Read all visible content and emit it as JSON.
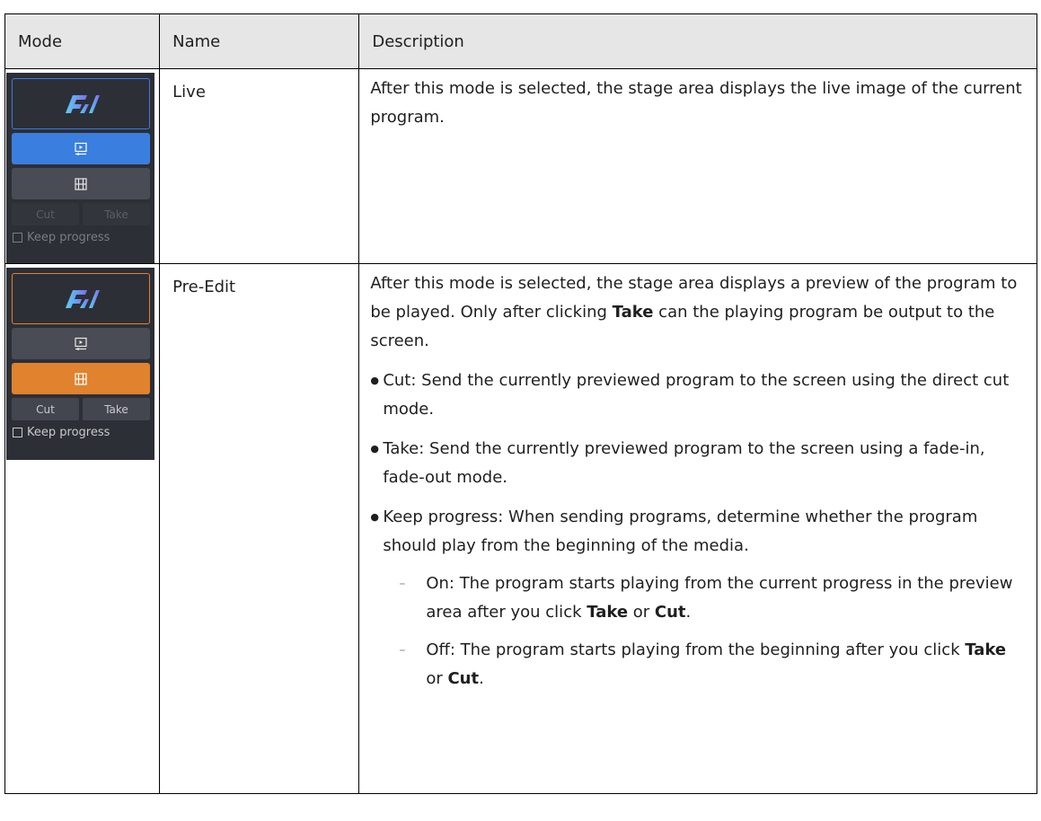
{
  "table": {
    "headers": [
      "Mode",
      "Name",
      "Description"
    ],
    "rows": [
      {
        "panel": {
          "cut_label": "Cut",
          "take_label": "Take",
          "keep_label": "Keep progress",
          "active_color": "#3a7fdf"
        },
        "name": "Live",
        "desc": "After this mode is selected, the stage area displays the live image of the current program."
      },
      {
        "panel": {
          "cut_label": "Cut",
          "take_label": "Take",
          "keep_label": "Keep progress",
          "active_color": "#e0822e"
        },
        "name": "Pre-Edit",
        "desc_intro_1": "After this mode is selected, the stage area displays a preview of the program to be played. Only after clicking ",
        "desc_intro_take": "Take",
        "desc_intro_2": " can the playing program be output to the screen.",
        "bullets": [
          "Cut: Send the currently previewed program to the screen using the direct cut mode.",
          "Take: Send the currently previewed program to the screen using a fade-in, fade-out mode.",
          "Keep progress: When sending programs, determine whether the program should play from the beginning of the media."
        ],
        "subs": [
          {
            "text": "On: The program starts playing from the current progress in the preview area after you click ",
            "b1": "Take",
            "mid": " or ",
            "b2": "Cut",
            "end": "."
          },
          {
            "text": "Off: The program starts playing from the beginning after you click ",
            "b1": "Take",
            "mid": " or ",
            "b2": "Cut",
            "end": "."
          }
        ]
      }
    ]
  },
  "icons": {
    "logo": "nova-logo-icon",
    "preview": "monitor-play-icon",
    "edit": "film-edit-icon",
    "checkbox": "checkbox-icon"
  }
}
